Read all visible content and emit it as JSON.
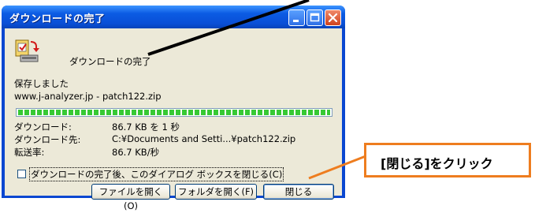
{
  "window": {
    "title": "ダウンロードの完了",
    "header_label": "ダウンロードの完了",
    "status": "保存しました",
    "source": "www.j-analyzer.jp - patch122.zip",
    "progress_fraction": 1.0,
    "info": [
      {
        "label": "ダウンロード:",
        "value": "86.7 KB を 1 秒"
      },
      {
        "label": "ダウンロード先:",
        "value": "C:¥Documents and Setti...¥patch122.zip"
      },
      {
        "label": "転送率:",
        "value": "86.7 KB/秒"
      }
    ],
    "checkbox_label": "ダウンロードの完了後、このダイアログ ボックスを閉じる(C)",
    "checkbox_checked": false,
    "buttons": {
      "open_file": "ファイルを開く(O)",
      "open_folder": "フォルダを開く(F)",
      "close": "閉じる"
    }
  },
  "callout": {
    "text": "[閉じる]をクリック",
    "border_color": "#ee7d1f"
  },
  "colors": {
    "titlebar": "#0a4fd6",
    "progress": "#37c934",
    "dialog_bg": "#ece9d8"
  },
  "icons": {
    "download_complete": "download-complete-icon",
    "minimize": "minimize-icon",
    "maximize": "maximize-icon",
    "close": "close-icon"
  }
}
